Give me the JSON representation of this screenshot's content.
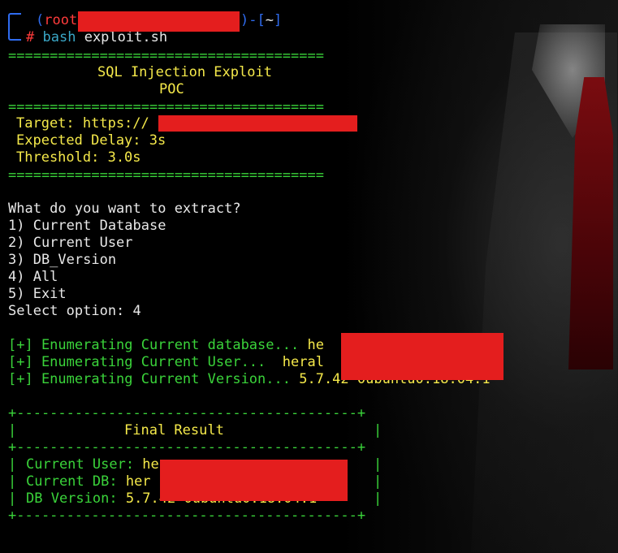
{
  "prompt": {
    "open_paren": "(",
    "user": "root",
    "close_paren": ")",
    "dash": "-",
    "dir_open": "[",
    "dir": "~",
    "dir_close": "]",
    "hash": "#",
    "command": "bash",
    "argument": "exploit.sh"
  },
  "banner": {
    "separator": "======================================",
    "title": "SQL Injection Exploit",
    "subtitle": "POC",
    "target_label": "Target: https://",
    "delay_line": "Expected Delay: 3s",
    "threshold_line": "Threshold: 3.0s"
  },
  "menu": {
    "question": "What do you want to extract?",
    "options": [
      "1) Current Database",
      "2) Current User",
      "3) DB_Version",
      "4) All",
      "5) Exit"
    ],
    "select_prompt": "Select option: 4"
  },
  "enumeration": {
    "db_label": "[+] Enumerating Current database... ",
    "db_value": "he",
    "user_label": "[+] Enumerating Current User...  ",
    "user_value": "heral",
    "version_label": "[+] Enumerating Current Version... ",
    "version_value": "5.7.42-0ubuntu0.18.04.1"
  },
  "result": {
    "border": "+-----------------------------------------+",
    "title": "Final Result",
    "user_label": "Current User: ",
    "user_value": "he",
    "db_label": "Current DB: ",
    "db_value": "her",
    "version_label": "DB Version: ",
    "version_value": "5.7.42-0ubuntu0.18.04.1",
    "side": "|"
  },
  "colors": {
    "separator": "#3ad33a",
    "text": "#e8e8e8",
    "value": "#f5e94a",
    "command": "#3aa7c7",
    "root": "#ff3b3b",
    "prompt": "#2f6cf0",
    "redaction": "#e41e1e"
  }
}
